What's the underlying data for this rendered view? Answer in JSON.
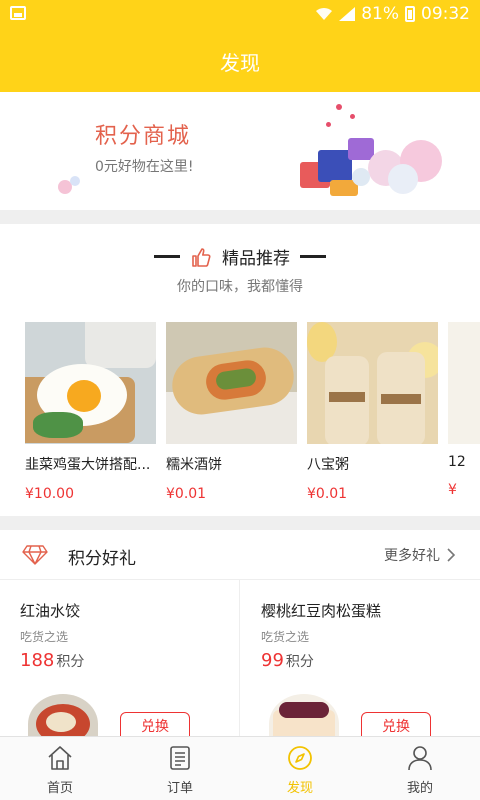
{
  "status_bar": {
    "signal_percent": "81%",
    "time": "09:32"
  },
  "header": {
    "title": "发现"
  },
  "banner": {
    "title": "积分商城",
    "subtitle": "0元好物在这里!"
  },
  "recommend": {
    "title": "精品推荐",
    "subtitle": "你的口味，我都懂得",
    "items": [
      {
        "name": "韭菜鸡蛋大饼搭配...",
        "price": "¥10.00"
      },
      {
        "name": "糯米酒饼",
        "price": "¥0.01"
      },
      {
        "name": "八宝粥",
        "price": "¥0.01"
      },
      {
        "name": "12",
        "price": "¥"
      }
    ]
  },
  "gifts": {
    "title": "积分好礼",
    "more": "更多好礼",
    "items": [
      {
        "name": "红油水饺",
        "tag": "吃货之选",
        "points": "188",
        "unit": "积分",
        "exchange": "兑换"
      },
      {
        "name": "樱桃红豆肉松蛋糕",
        "tag": "吃货之选",
        "points": "99",
        "unit": "积分",
        "exchange": "兑换"
      }
    ]
  },
  "tabbar": {
    "items": [
      {
        "label": "首页"
      },
      {
        "label": "订单"
      },
      {
        "label": "发现"
      },
      {
        "label": "我的"
      }
    ],
    "active_color": "#f2c200"
  },
  "colors": {
    "brand": "#ffd318",
    "price": "#e33333",
    "banner_title": "#e3624d"
  }
}
